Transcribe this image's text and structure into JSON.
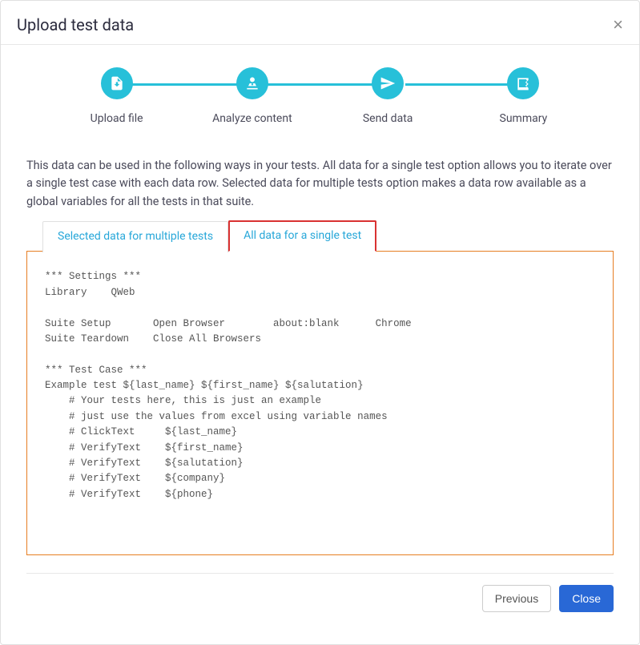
{
  "header": {
    "title": "Upload test data"
  },
  "stepper": {
    "steps": [
      {
        "label": "Upload file"
      },
      {
        "label": "Analyze content"
      },
      {
        "label": "Send data"
      },
      {
        "label": "Summary"
      }
    ]
  },
  "description": "This data can be used in the following ways in your tests. All data for a single test option allows you to iterate over a single test case with each data row. Selected data for multiple tests option makes a data row available as a global variables for all the tests in that suite.",
  "tabs": {
    "tab1_label": "Selected data for multiple tests",
    "tab2_label": "All data for a single test"
  },
  "code": "*** Settings ***\nLibrary    QWeb\n\nSuite Setup       Open Browser        about:blank      Chrome\nSuite Teardown    Close All Browsers\n\n*** Test Case ***\nExample test ${last_name} ${first_name} ${salutation}\n    # Your tests here, this is just an example\n    # just use the values from excel using variable names\n    # ClickText     ${last_name}\n    # VerifyText    ${first_name}\n    # VerifyText    ${salutation}\n    # VerifyText    ${company}\n    # VerifyText    ${phone}",
  "footer": {
    "previous_label": "Previous",
    "close_label": "Close"
  }
}
